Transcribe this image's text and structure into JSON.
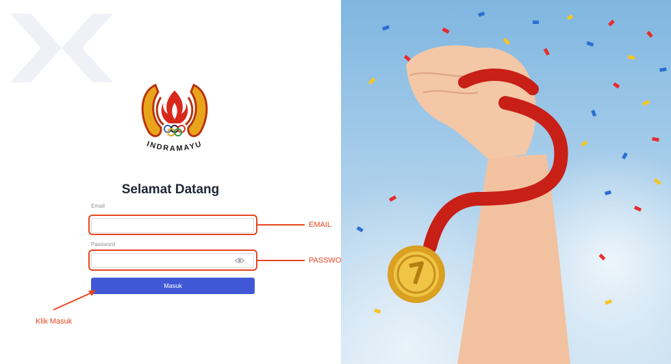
{
  "brand": {
    "name": "INDRAMAYU"
  },
  "login": {
    "title": "Selamat Datang",
    "email_label": "Email",
    "email_value": "",
    "password_label": "Password",
    "password_value": "",
    "submit_label": "Masuk"
  },
  "annotations": {
    "email": "EMAIL",
    "password": "PASSWORD",
    "click": "Klik Masuk"
  },
  "colors": {
    "accent": "#4058d6",
    "annotation": "#e8441d",
    "medal_ribbon": "#c81f17",
    "medal": "#e3b22e"
  }
}
